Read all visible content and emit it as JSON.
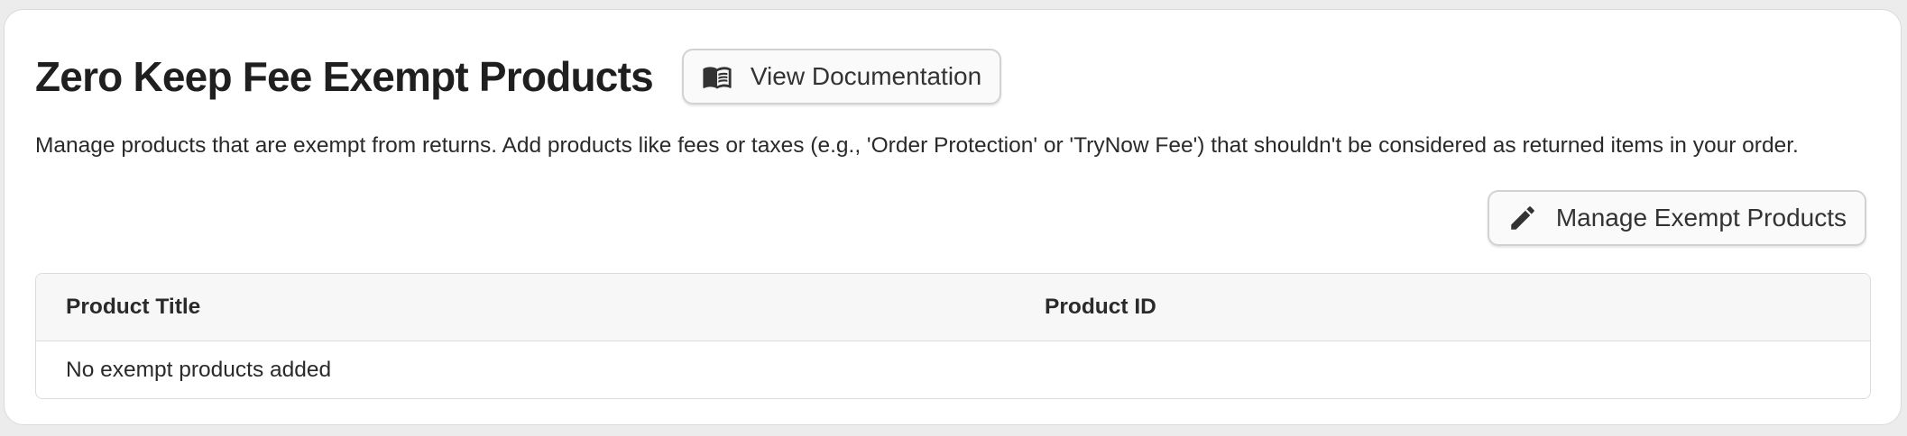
{
  "page": {
    "title": "Zero Keep Fee Exempt Products",
    "description": "Manage products that are exempt from returns. Add products like fees or taxes (e.g., 'Order Protection' or 'TryNow Fee') that shouldn't be considered as returned items in your order."
  },
  "buttons": {
    "view_docs": {
      "label": "View Documentation",
      "icon": "book-open-icon"
    },
    "manage_exempt": {
      "label": "Manage Exempt Products",
      "icon": "pencil-icon"
    }
  },
  "table": {
    "columns": [
      "Product Title",
      "Product ID"
    ],
    "empty_message": "No exempt products added"
  },
  "colors": {
    "card_background": "#ffffff",
    "page_background": "#ececec",
    "button_background": "#fafafa",
    "table_header_background": "#f7f7f7",
    "text": "#1f1f1f"
  }
}
